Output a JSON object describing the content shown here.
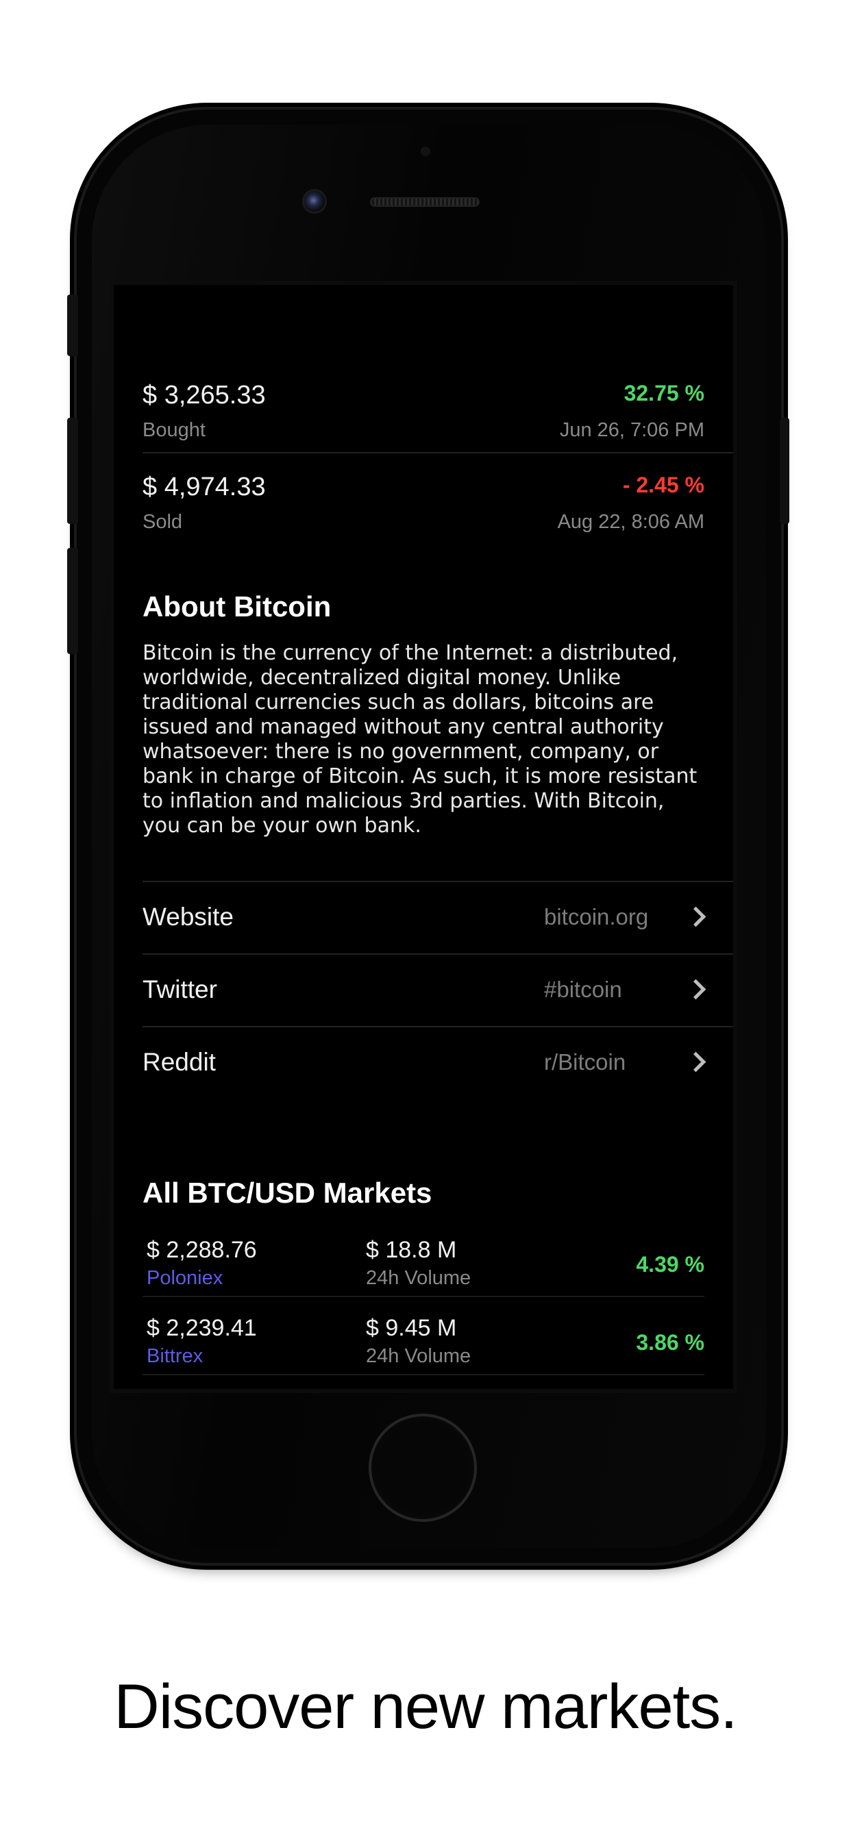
{
  "trades": [
    {
      "price": "$ 3,265.33",
      "type": "Bought",
      "change": "32.75 %",
      "date": "Jun 26, 7:06 PM"
    },
    {
      "price": "$ 4,974.33",
      "type": "Sold",
      "change": "- 2.45 %",
      "date": "Aug 22, 8:06 AM"
    }
  ],
  "about": {
    "title": "About Bitcoin",
    "text": "Bitcoin is the currency of the Internet: a distributed, worldwide, decentralized digital money. Unlike traditional currencies such as dollars, bitcoins are issued and managed without any central authority whatsoever: there is no government, company, or bank in charge of Bitcoin. As such, it is more resistant to inflation and malicious 3rd parties. With Bitcoin, you can be your own bank."
  },
  "links": [
    {
      "label": "Website",
      "value": "bitcoin.org"
    },
    {
      "label": "Twitter",
      "value": "#bitcoin"
    },
    {
      "label": "Reddit",
      "value": "r/Bitcoin"
    }
  ],
  "markets": {
    "title": "All BTC/USD Markets",
    "rows": [
      {
        "price": "$ 2,288.76",
        "exchange": "Poloniex",
        "volume": "$ 18.8 M",
        "volume_label": "24h Volume",
        "change": "4.39 %"
      },
      {
        "price": "$ 2,239.41",
        "exchange": "Bittrex",
        "volume": "$ 9.45 M",
        "volume_label": "24h Volume",
        "change": "3.86 %"
      }
    ]
  },
  "colors": {
    "positive": "#4cd964",
    "negative": "#ff3b30",
    "exchange_link": "#5e5ce6"
  },
  "caption": "Discover new markets."
}
